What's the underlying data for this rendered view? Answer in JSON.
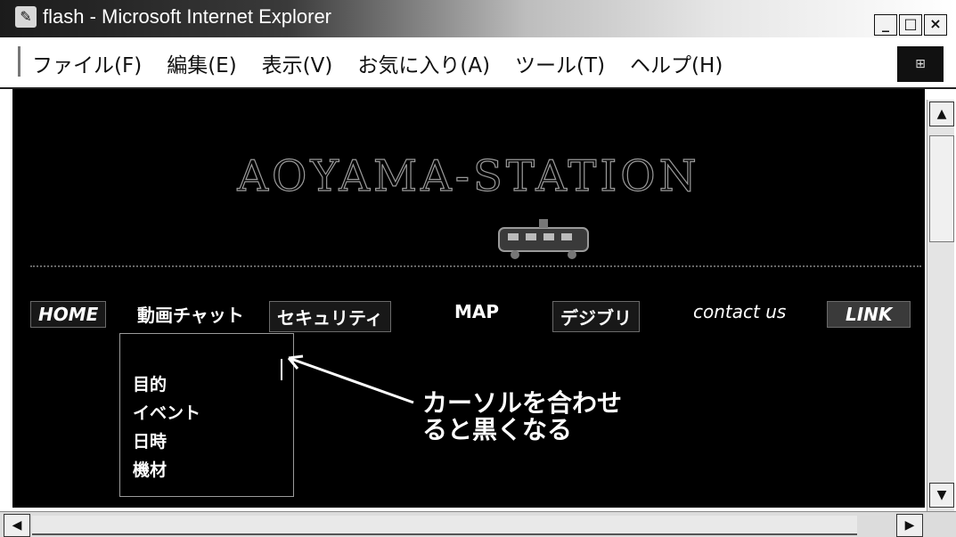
{
  "window": {
    "title": "flash - Microsoft Internet Explorer",
    "controls": [
      "_",
      "□",
      "×"
    ]
  },
  "menu": {
    "items": [
      "ファイル(F)",
      "編集(E)",
      "表示(V)",
      "お気に入り(A)",
      "ツール(T)",
      "ヘルプ(H)"
    ]
  },
  "site": {
    "title": "AOYAMA-STATION"
  },
  "nav": {
    "home": "HOME",
    "video_chat": "動画チャット",
    "security": "セキュリティ",
    "map": "MAP",
    "digibri": "デジブリ",
    "contact": "contact us",
    "link": "LINK"
  },
  "dropdown": {
    "items": [
      "目的",
      "イベント",
      "日時",
      "機材"
    ]
  },
  "annotation": {
    "line1": "カーソルを合わせ",
    "line2": "ると黒くなる"
  },
  "scrollbar": {
    "up": "▲",
    "down": "▼",
    "left": "◀",
    "right": "▶"
  }
}
